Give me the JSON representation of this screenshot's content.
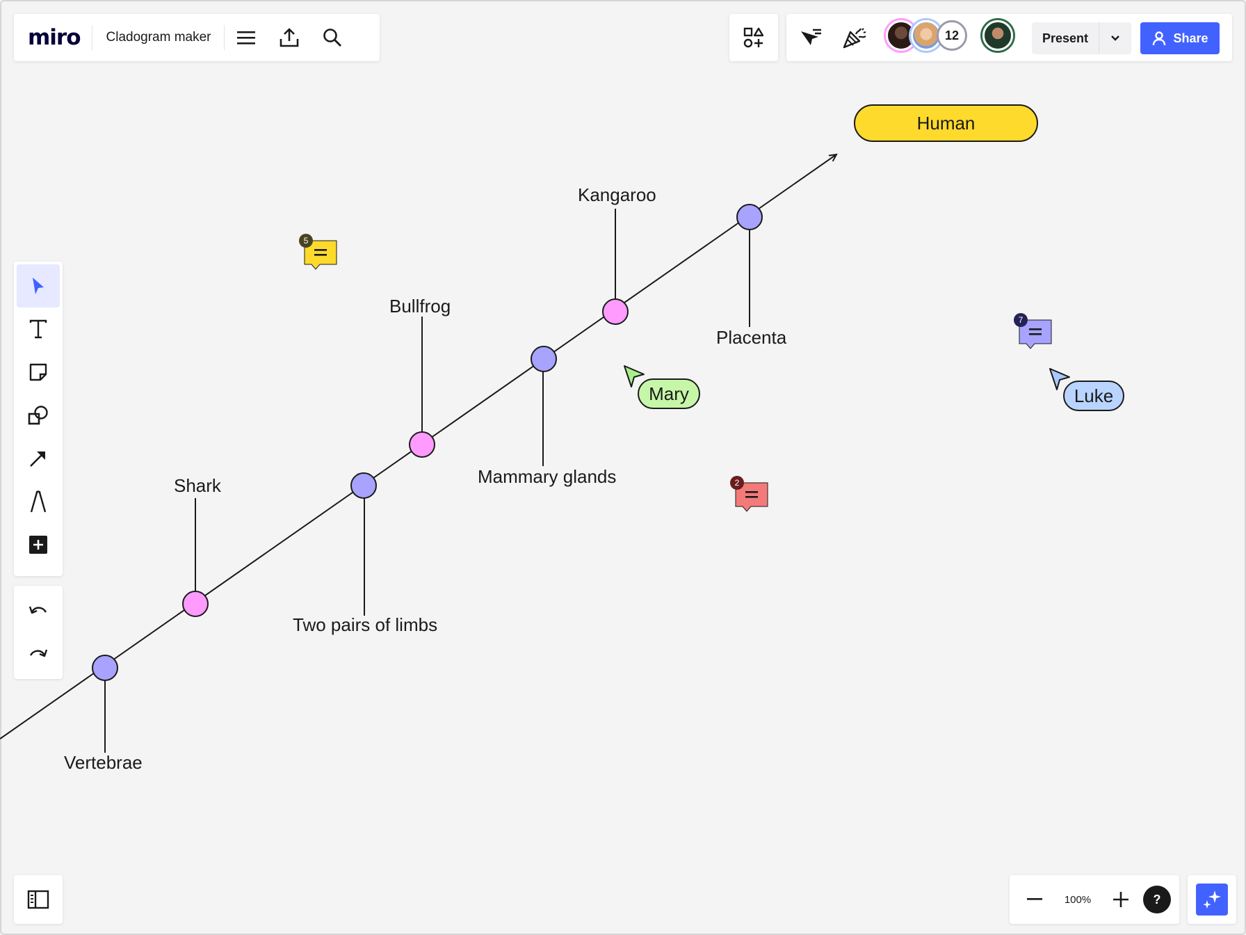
{
  "app": {
    "logo": "miro",
    "board_title": "Cladogram maker"
  },
  "header": {
    "collaborator_count": "12",
    "present_label": "Present",
    "share_label": "Share"
  },
  "board": {
    "outcome": "Human",
    "taxa": [
      "Shark",
      "Bullfrog",
      "Kangaroo"
    ],
    "traits": [
      "Vertebrae",
      "Two pairs of limbs",
      "Mammary glands",
      "Placenta"
    ]
  },
  "cursors": [
    {
      "name": "Mary",
      "color": "#c6f7a8",
      "arrow_color": "#a7f08a"
    },
    {
      "name": "Luke",
      "color": "#b9d4ff",
      "arrow_color": "#a9c8ff"
    }
  ],
  "comments": [
    {
      "count": "5",
      "color": "#fdda2c",
      "badge_color": "#4a4320"
    },
    {
      "count": "7",
      "color": "#a7a3ff",
      "badge_color": "#252258"
    },
    {
      "count": "2",
      "color": "#f47a7a",
      "badge_color": "#6b1d1d"
    }
  ],
  "colors": {
    "accent": "#4262ff",
    "node_purple": "#a7a3ff",
    "node_pink": "#ff9bff",
    "human_yellow": "#fdda2c"
  },
  "icons": {
    "menu": "hamburger-icon",
    "export": "upload-icon",
    "search": "search-icon",
    "apps": "apps-icon",
    "cursor_filter": "cursor-filter-icon",
    "celebrate": "party-popper-icon"
  },
  "zoom": {
    "level": "100%"
  },
  "help_label": "?"
}
